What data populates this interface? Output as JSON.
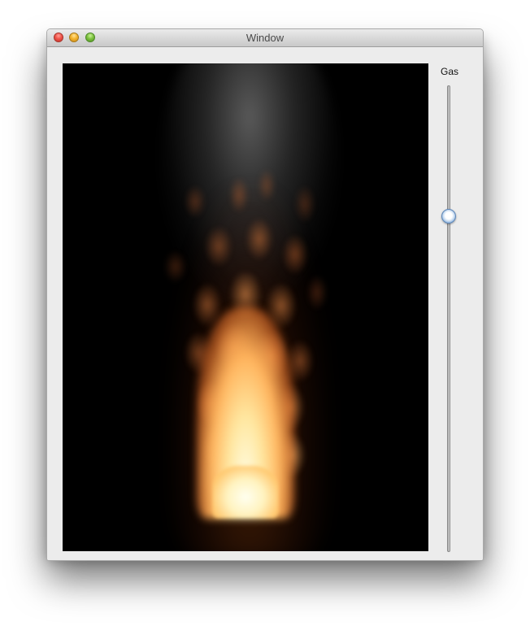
{
  "window": {
    "title": "Window"
  },
  "titlebar_buttons": {
    "close": "close-icon",
    "minimize": "minimize-icon",
    "zoom": "zoom-icon"
  },
  "gl_view": {
    "content": "fire-particle-simulation",
    "background": "#000000"
  },
  "slider": {
    "label": "Gas",
    "orientation": "vertical",
    "value_fraction": 0.72,
    "accent_color": "#6f9ed3"
  }
}
